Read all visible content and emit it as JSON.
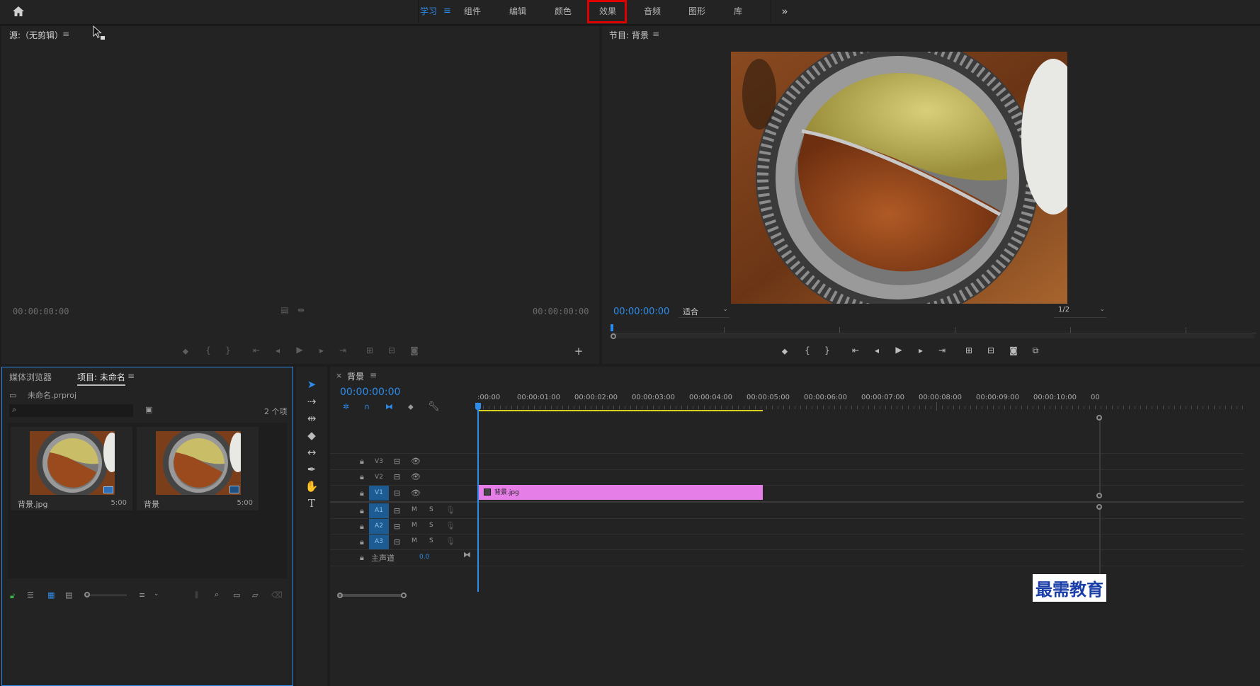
{
  "workspaces": {
    "tabs": [
      "学习",
      "组件",
      "编辑",
      "颜色",
      "效果",
      "音频",
      "图形",
      "库"
    ],
    "menu_glyph": "≡",
    "overflow": "»",
    "highlighted_tab": "效果"
  },
  "source_monitor": {
    "title": "源:（无剪辑）",
    "menu_glyph": "≡",
    "timecode_left": "00:00:00:00",
    "timecode_right": "00:00:00:00"
  },
  "program_monitor": {
    "title": "节目: 背景",
    "menu_glyph": "≡",
    "timecode": "00:00:00:00",
    "fit_label": "适合",
    "resolution": "1/2"
  },
  "project_panel": {
    "tab_media_browser": "媒体浏览器",
    "tab_project": "项目: 未命名",
    "project_file": "未命名.prproj",
    "item_count": "2 个项",
    "search_placeholder": "",
    "items": [
      {
        "name": "背景.jpg",
        "duration": "5:00"
      },
      {
        "name": "背景",
        "duration": "5:00"
      }
    ]
  },
  "timeline": {
    "close": "×",
    "sequence_name": "背景",
    "menu_glyph": "≡",
    "timecode": "00:00:00:00",
    "ruler_labels": [
      ":00:00",
      "00:00:01:00",
      "00:00:02:00",
      "00:00:03:00",
      "00:00:04:00",
      "00:00:05:00",
      "00:00:06:00",
      "00:00:07:00",
      "00:00:08:00",
      "00:00:09:00",
      "00:00:10:00",
      "00"
    ],
    "video_tracks": [
      "V3",
      "V2",
      "V1"
    ],
    "audio_tracks": [
      "A1",
      "A2",
      "A3"
    ],
    "mute_label": "M",
    "solo_label": "S",
    "master_label": "主声道",
    "master_value": "0.0",
    "clip_name": "背景.jpg"
  },
  "watermark": "最需教育",
  "colors": {
    "accent_blue": "#2d8ceb",
    "highlight_red": "#e00000",
    "clip_pink": "#e57ee6",
    "track_blue": "#1c5c92"
  }
}
